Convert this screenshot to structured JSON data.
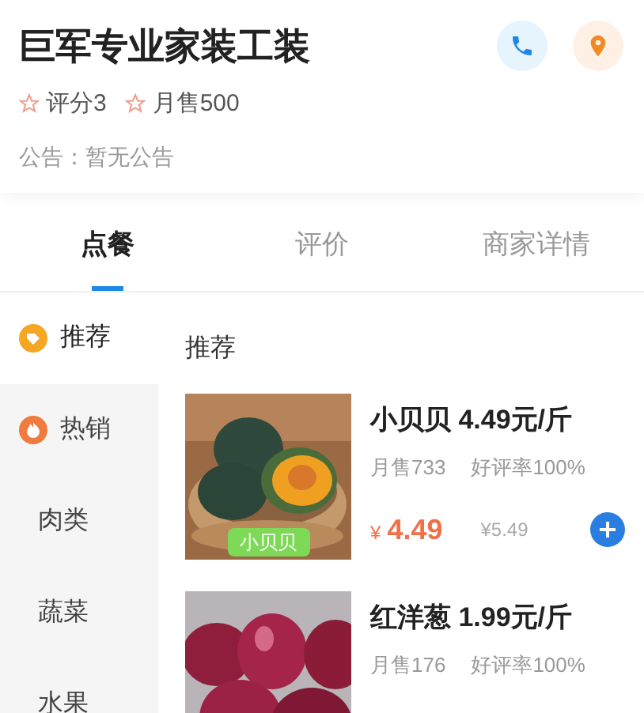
{
  "shop": {
    "name": "巨军专业家装工装",
    "rating": "评分3",
    "monthly_sales": "月售500",
    "notice": "公告：暂无公告"
  },
  "tabs": [
    {
      "label": "点餐",
      "selected": true
    },
    {
      "label": "评价",
      "selected": false
    },
    {
      "label": "商家详情",
      "selected": false
    }
  ],
  "categories": [
    {
      "label": "推荐",
      "kind": "tag",
      "selected": true
    },
    {
      "label": "热销",
      "kind": "flame",
      "selected": false
    },
    {
      "label": "肉类",
      "kind": "plain",
      "selected": false
    },
    {
      "label": "蔬菜",
      "kind": "plain",
      "selected": false
    },
    {
      "label": "水果",
      "kind": "plain",
      "selected": false
    }
  ],
  "section_title": "推荐",
  "products": [
    {
      "name": "小贝贝 4.49元/斤",
      "sales": "月售733",
      "rating": "好评率100%",
      "tag": "小贝贝",
      "currency": "¥",
      "price": "4.49",
      "original_price": "¥5.49"
    },
    {
      "name": "红洋葱 1.99元/斤",
      "sales": "月售176",
      "rating": "好评率100%"
    }
  ]
}
